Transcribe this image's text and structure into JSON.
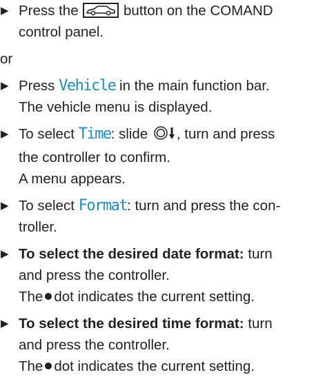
{
  "steps": [
    {
      "a": "Press the",
      "b": "button on the COMAND",
      "c": "control panel."
    },
    {
      "or": "or"
    },
    {
      "a": "Press",
      "hl": "Vehicle",
      "b": "in the main function bar.",
      "result": "The vehicle menu is displayed."
    },
    {
      "a": "To select",
      "hl": "Time",
      "b": ": slide",
      "c": ", turn and press",
      "d": "the controller to confirm.",
      "result": "A menu appears."
    },
    {
      "a": "To select",
      "hl": "Format",
      "b": ": turn and press the con-",
      "c": "troller."
    },
    {
      "bold": "To select the desired date format:",
      "a": "turn",
      "b": "and press the controller.",
      "c": "The",
      "d": "dot indicates the current setting."
    },
    {
      "bold": "To select the desired time format:",
      "a": "turn",
      "b": "and press the controller.",
      "c": "The",
      "d": "dot indicates the current setting."
    }
  ],
  "icons": {
    "arrow": "▶",
    "vehicle_button": "car-button-icon",
    "controller": "controller-slide-down-icon",
    "dot": "filled-dot-icon"
  }
}
